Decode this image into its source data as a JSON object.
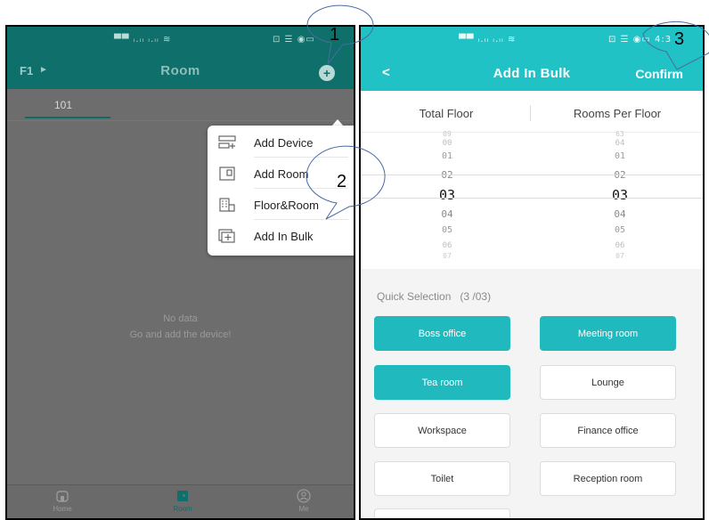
{
  "left_screen": {
    "status_signal": "▀▀ ᵢ.ᵢᵢ ᵢ.ᵢᵢ ≋",
    "status_right": "⊡ ☰ ◉▭",
    "floor": "F1",
    "floor_arrow": "►",
    "title": "Room",
    "add_button": "+",
    "tabs": [
      {
        "label": "101"
      }
    ],
    "popup_menu": [
      {
        "label": "Add Device",
        "icon": "add-device-icon"
      },
      {
        "label": "Add Room",
        "icon": "add-room-icon"
      },
      {
        "label": "Floor&Room",
        "icon": "floor-room-icon"
      },
      {
        "label": "Add In Bulk",
        "icon": "add-in-bulk-icon"
      }
    ],
    "empty_state": {
      "title": "No data",
      "subtitle": "Go and add the device!"
    },
    "bottom_nav": [
      {
        "label": "Home",
        "icon": "home-icon",
        "active": false
      },
      {
        "label": "Room",
        "icon": "room-icon",
        "active": true
      },
      {
        "label": "Me",
        "icon": "me-icon",
        "active": false
      }
    ]
  },
  "right_screen": {
    "status_signal": "▀▀ ᵢ.ᵢᵢ ᵢ.ᵢᵢ ≋",
    "status_right": "⊡ ☰ ◉▭ 4:3",
    "back": "<",
    "title": "Add In Bulk",
    "confirm": "Confirm",
    "picker": {
      "columns": [
        {
          "header": "Total Floor",
          "items": [
            "09",
            "00",
            "01",
            "02",
            "03",
            "04",
            "05",
            "06",
            "07"
          ],
          "selected": "03"
        },
        {
          "header": "Rooms Per Floor",
          "items": [
            "63",
            "64",
            "01",
            "02",
            "03",
            "04",
            "05",
            "06",
            "07"
          ],
          "selected": "03"
        }
      ]
    },
    "quick_selection": {
      "label": "Quick Selection",
      "count": "(3 /03)"
    },
    "rooms": [
      {
        "label": "Boss office",
        "selected": true
      },
      {
        "label": "Meeting room",
        "selected": true
      },
      {
        "label": "Tea room",
        "selected": true
      },
      {
        "label": "Lounge",
        "selected": false
      },
      {
        "label": "Workspace",
        "selected": false
      },
      {
        "label": "Finance office",
        "selected": false
      },
      {
        "label": "Toilet",
        "selected": false
      },
      {
        "label": "Reception room",
        "selected": false
      },
      {
        "label": "",
        "selected": false
      }
    ]
  },
  "annotations": [
    {
      "number": "1"
    },
    {
      "number": "2"
    },
    {
      "number": "3"
    }
  ],
  "colors": {
    "left_header": "#0f6f6a",
    "left_dim_bg": "#6d6d6d",
    "accent_teal": "#20c2c6",
    "selected_button": "#20b9bd"
  }
}
